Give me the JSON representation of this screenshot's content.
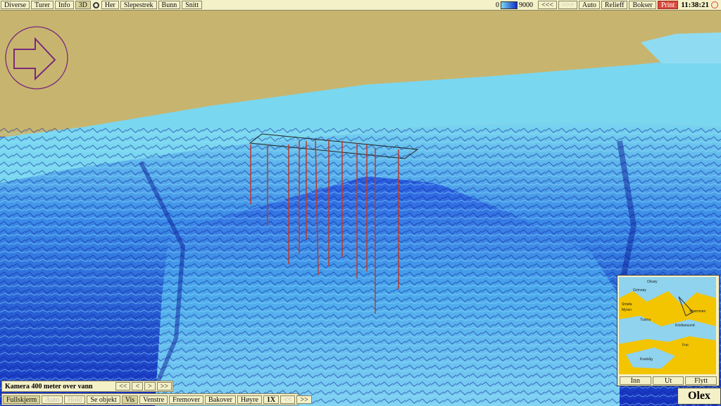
{
  "toolbar": {
    "menu_items": [
      "Diverse",
      "Turer",
      "Info",
      "3D",
      "Her",
      "Slepestrek",
      "Bunn",
      "Snitt"
    ],
    "depth_scale_min": "0",
    "depth_scale_max": "9000",
    "back_label": "<<<",
    "forward_label": ">>>",
    "auto_label": "Auto",
    "relieff_label": "Relieff",
    "bokser_label": "Bokser",
    "print_label": "Print",
    "time": "11:38:21"
  },
  "camera": {
    "label": "Kamera 400 meter over vann",
    "buttons": [
      "<<",
      "<",
      ">",
      ">>"
    ]
  },
  "bottom_bar": {
    "items": [
      "Fullskjerm",
      "Auto",
      "Hold",
      "Se objekt",
      "Vis",
      "Venstre",
      "Fremover",
      "Bakover",
      "Høyre",
      "1X",
      "<<",
      ">>"
    ]
  },
  "minimap": {
    "place_names": [
      "Oksøy",
      "Grimsøy",
      "Smøla",
      "Myren",
      "Tustna",
      "Strømmen",
      "Kristiansund",
      "Frei",
      "Kvalvåg"
    ],
    "buttons": [
      "Inn",
      "Ut",
      "Flytt"
    ]
  },
  "logo": "Olex",
  "colors": {
    "land": "#c7b56f",
    "shallow_water": "#7ad7f0",
    "deep_water": "#1030c8",
    "ui_panel": "#f4f0c8",
    "fishing_line": "#c0392b"
  }
}
